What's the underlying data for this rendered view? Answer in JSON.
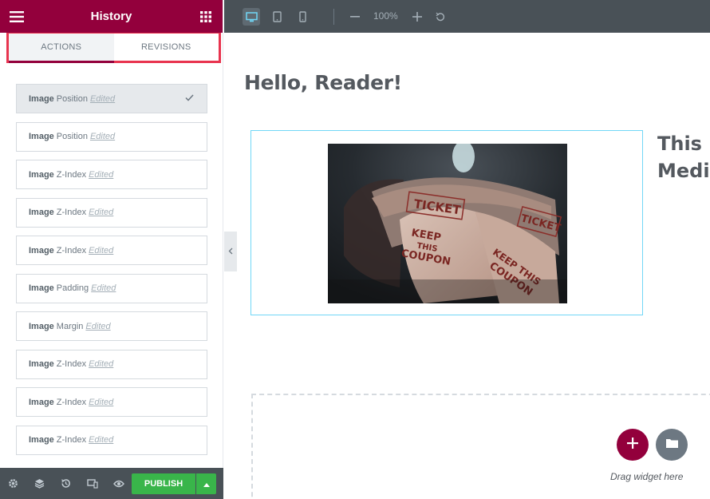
{
  "panel": {
    "title": "History",
    "menu_icon": "hamburger-icon",
    "apps_icon": "grid-icon",
    "tabs": [
      {
        "label": "ACTIONS",
        "active": true
      },
      {
        "label": "REVISIONS",
        "active": false
      }
    ],
    "actions": [
      {
        "element": "Image",
        "property": "Position",
        "status": "Edited",
        "current": true
      },
      {
        "element": "Image",
        "property": "Position",
        "status": "Edited",
        "current": false
      },
      {
        "element": "Image",
        "property": "Z-Index",
        "status": "Edited",
        "current": false
      },
      {
        "element": "Image",
        "property": "Z-Index",
        "status": "Edited",
        "current": false
      },
      {
        "element": "Image",
        "property": "Z-Index",
        "status": "Edited",
        "current": false
      },
      {
        "element": "Image",
        "property": "Padding",
        "status": "Edited",
        "current": false
      },
      {
        "element": "Image",
        "property": "Margin",
        "status": "Edited",
        "current": false
      },
      {
        "element": "Image",
        "property": "Z-Index",
        "status": "Edited",
        "current": false
      },
      {
        "element": "Image",
        "property": "Z-Index",
        "status": "Edited",
        "current": false
      },
      {
        "element": "Image",
        "property": "Z-Index",
        "status": "Edited",
        "current": false
      }
    ],
    "footer": {
      "icons": [
        "settings-icon",
        "layers-icon",
        "history-icon",
        "responsive-icon",
        "preview-icon"
      ],
      "publish_label": "PUBLISH"
    }
  },
  "toolbar": {
    "devices": [
      "desktop-icon",
      "tablet-icon",
      "mobile-icon"
    ],
    "active_device": "desktop",
    "zoom": "100%"
  },
  "canvas": {
    "heading": "Hello, Reader!",
    "side_heading_line1": "This is",
    "side_heading_line2": "Media",
    "image_ticket_words": [
      "TICKET",
      "KEEP",
      "THIS",
      "COUPON",
      "TICKET",
      "KEEP THIS",
      "COUPON"
    ],
    "drag_hint": "Drag widget here"
  },
  "colors": {
    "brand": "#93003c",
    "toolbar": "#495157",
    "publish": "#39b54a",
    "highlight_border": "#e8344f",
    "selected_widget_border": "#71d7f7"
  }
}
